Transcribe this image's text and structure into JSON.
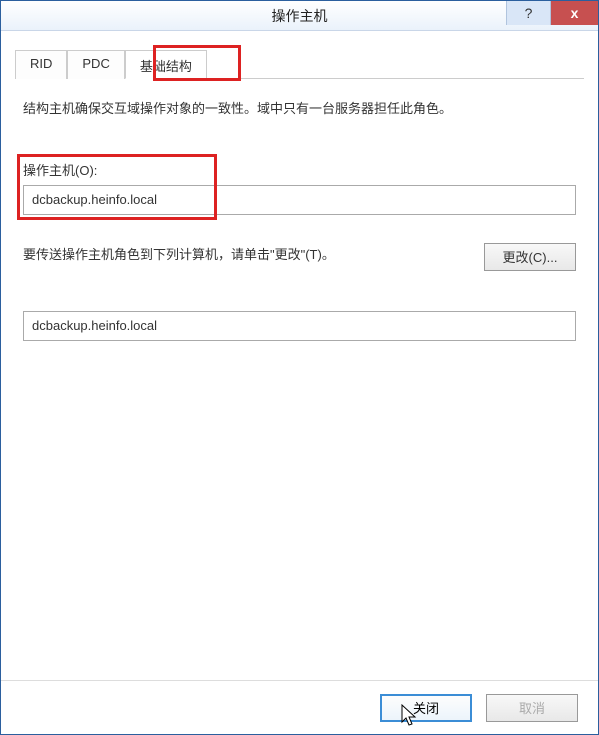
{
  "window": {
    "title": "操作主机"
  },
  "titlebar": {
    "help_label": "?",
    "close_label": "x"
  },
  "tabs": {
    "items": [
      {
        "label": "RID"
      },
      {
        "label": "PDC"
      },
      {
        "label": "基础结构"
      }
    ],
    "active_index": 2
  },
  "body": {
    "description": "结构主机确保交互域操作对象的一致性。域中只有一台服务器担任此角色。",
    "operations_master_label": "操作主机(O):",
    "operations_master_value": "dcbackup.heinfo.local",
    "transfer_text": "要传送操作主机角色到下列计算机，请单击\"更改\"(T)。",
    "change_button": "更改(C)...",
    "target_value": "dcbackup.heinfo.local"
  },
  "footer": {
    "close_label": "关闭",
    "cancel_label": "取消"
  }
}
